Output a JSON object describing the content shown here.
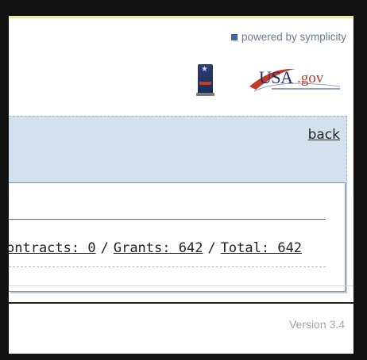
{
  "header": {
    "powered_by": "powered by symplicity",
    "logo_text_usa": "USA",
    "logo_text_gov": ".gov"
  },
  "panel": {
    "back_label": "back"
  },
  "summary": {
    "contracts_label": "ontracts: 0",
    "grants_label": "Grants: 642",
    "total_label": "Total: 642",
    "separator": "/"
  },
  "footer": {
    "version": "Version 3.4"
  },
  "colors": {
    "frame": "#111111",
    "panel_bg": "#d3e1ef",
    "brand_blue": "#1b2f6b",
    "brand_red": "#c0392b",
    "muted_text": "#a5a5a5"
  },
  "icons": {
    "powered_marker": "square-bullet-icon",
    "badge": "agency-badge-icon",
    "logo": "usa-gov-logo"
  }
}
